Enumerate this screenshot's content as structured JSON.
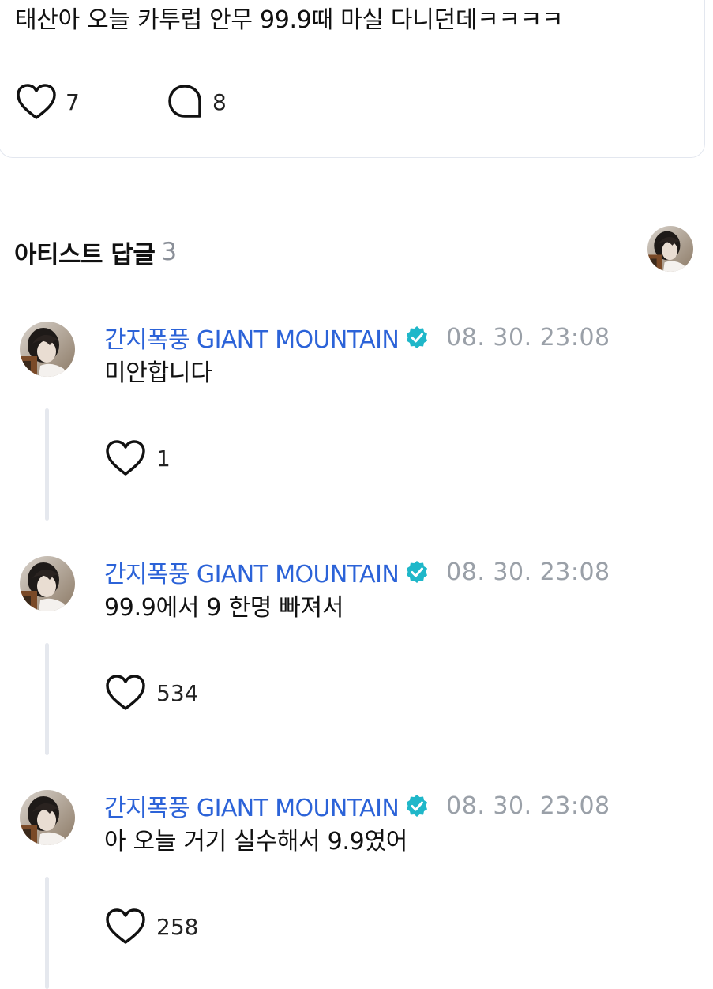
{
  "post": {
    "text": "태산아 오늘 카투럽 안무 99.9때 마실 다니던데ㅋㅋㅋㅋ",
    "like_count": "7",
    "comment_count": "8"
  },
  "artist_replies": {
    "title": "아티스트 답글",
    "count": "3",
    "items": [
      {
        "author": "간지폭풍 GIANT MOUNTAIN",
        "timestamp": "08. 30. 23:08",
        "text": "미안합니다",
        "like_count": "1"
      },
      {
        "author": "간지폭풍 GIANT MOUNTAIN",
        "timestamp": "08. 30. 23:08",
        "text": "99.9에서 9 한명 빠져서",
        "like_count": "534"
      },
      {
        "author": "간지폭풍 GIANT MOUNTAIN",
        "timestamp": "08. 30. 23:08",
        "text": "아 오늘 거기 실수해서 9.9였어",
        "like_count": "258"
      }
    ]
  },
  "colors": {
    "author_blue": "#2c63d8",
    "verified_teal": "#1fb7c9",
    "muted_gray": "#9aa0a8",
    "thread_line": "#e5e8ee"
  },
  "icons": {
    "like": "heart-outline-icon",
    "comment": "speech-bubble-icon",
    "verified": "verified-badge-icon"
  }
}
